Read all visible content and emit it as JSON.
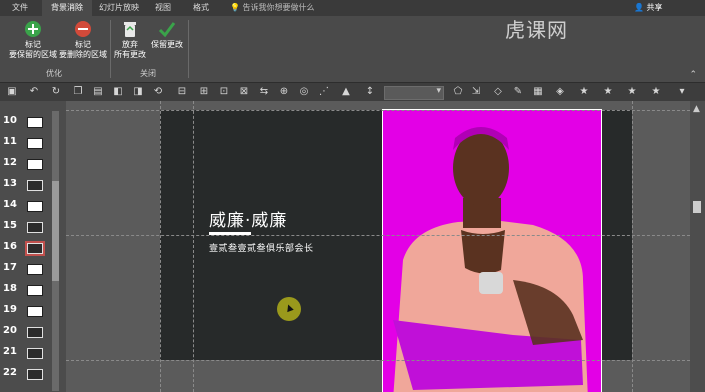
{
  "tabs": [
    {
      "label": "文件",
      "active": false
    },
    {
      "label": "背景消除",
      "active": true
    },
    {
      "label": "幻灯片放映",
      "active": false
    },
    {
      "label": "视图",
      "active": false
    },
    {
      "label": "格式",
      "active": false
    }
  ],
  "tell_me": "告诉我你想要做什么",
  "share_label": "共享",
  "watermark": "虎课网",
  "ribbon": {
    "mark_keep": {
      "line1": "标记",
      "line2": "要保留的区域",
      "icon": "plus-circle-icon"
    },
    "mark_remove": {
      "line1": "标记",
      "line2": "要删除的区域",
      "icon": "minus-circle-icon"
    },
    "discard": {
      "line1": "放弃",
      "line2": "所有更改",
      "icon": "recycle-bin-icon"
    },
    "keep_changes": {
      "line1": "保留更改",
      "icon": "checkmark-icon"
    },
    "group_optimize": "优化",
    "group_close": "关闭",
    "colors": {
      "keep": "#3aa34a",
      "remove": "#d24a3a",
      "check": "#3aa34a"
    }
  },
  "thumbnails": [
    {
      "num": "10",
      "selected": false,
      "dark": false
    },
    {
      "num": "11",
      "selected": false,
      "dark": false
    },
    {
      "num": "12",
      "selected": false,
      "dark": false
    },
    {
      "num": "13",
      "selected": false,
      "dark": true
    },
    {
      "num": "14",
      "selected": false,
      "dark": false
    },
    {
      "num": "15",
      "selected": false,
      "dark": true
    },
    {
      "num": "16",
      "selected": true,
      "dark": true
    },
    {
      "num": "17",
      "selected": false,
      "dark": false
    },
    {
      "num": "18",
      "selected": false,
      "dark": false
    },
    {
      "num": "19",
      "selected": false,
      "dark": false
    },
    {
      "num": "20",
      "selected": false,
      "dark": true
    },
    {
      "num": "21",
      "selected": false,
      "dark": true
    },
    {
      "num": "22",
      "selected": false,
      "dark": true
    }
  ],
  "slide": {
    "title": "威廉·威廉",
    "subtitle": "壹贰叁壹贰叁俱乐部会长",
    "background": "#272a2a",
    "photo_bg": "#e300e6"
  }
}
